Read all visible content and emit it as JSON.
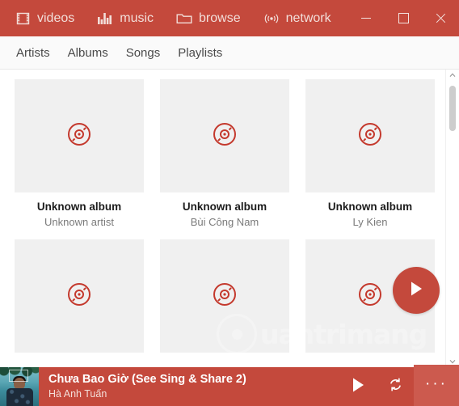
{
  "theme": {
    "accent": "#c4493c",
    "accent_dark": "#b23f33",
    "accent_light": "#cc5a4e",
    "disc_icon_color": "#c4392d",
    "art_placeholder_bg": "#f0f0f0",
    "tabbar_bg": "#fafafa",
    "text_primary": "#1c1c1c",
    "text_secondary": "#7a7a7a"
  },
  "titlebar": {
    "nav": [
      {
        "label": "videos",
        "icon": "film-strip-icon"
      },
      {
        "label": "music",
        "icon": "equalizer-icon"
      },
      {
        "label": "browse",
        "icon": "folder-icon"
      },
      {
        "label": "network",
        "icon": "broadcast-icon"
      }
    ],
    "window_controls": {
      "minimize": "minimize-icon",
      "maximize": "maximize-icon",
      "close": "close-icon"
    }
  },
  "tabs": [
    {
      "label": "Artists"
    },
    {
      "label": "Albums"
    },
    {
      "label": "Songs"
    },
    {
      "label": "Playlists"
    }
  ],
  "library": {
    "albums": [
      {
        "title": "Unknown album",
        "artist": "Unknown artist",
        "art": "disc-placeholder-icon"
      },
      {
        "title": "Unknown album",
        "artist": "Bùi Công Nam",
        "art": "disc-placeholder-icon"
      },
      {
        "title": "Unknown album",
        "artist": "Ly Kien",
        "art": "disc-placeholder-icon"
      },
      {
        "title": "",
        "artist": "",
        "art": "disc-placeholder-icon"
      },
      {
        "title": "",
        "artist": "",
        "art": "disc-placeholder-icon"
      },
      {
        "title": "",
        "artist": "",
        "art": "disc-placeholder-icon"
      }
    ]
  },
  "fab": {
    "icon": "play-icon"
  },
  "scrollbar": {
    "up_arrow": "chevron-up-icon",
    "down_arrow": "chevron-down-icon"
  },
  "player": {
    "title": "Chưa Bao Giờ (See Sing & Share 2)",
    "artist": "Hà Anh Tuấn",
    "album_art": "album-art-thumbnail",
    "play_icon": "play-icon",
    "repeat_icon": "repeat-icon",
    "more_label": "···"
  },
  "watermark": {
    "text": "uantrimang"
  }
}
